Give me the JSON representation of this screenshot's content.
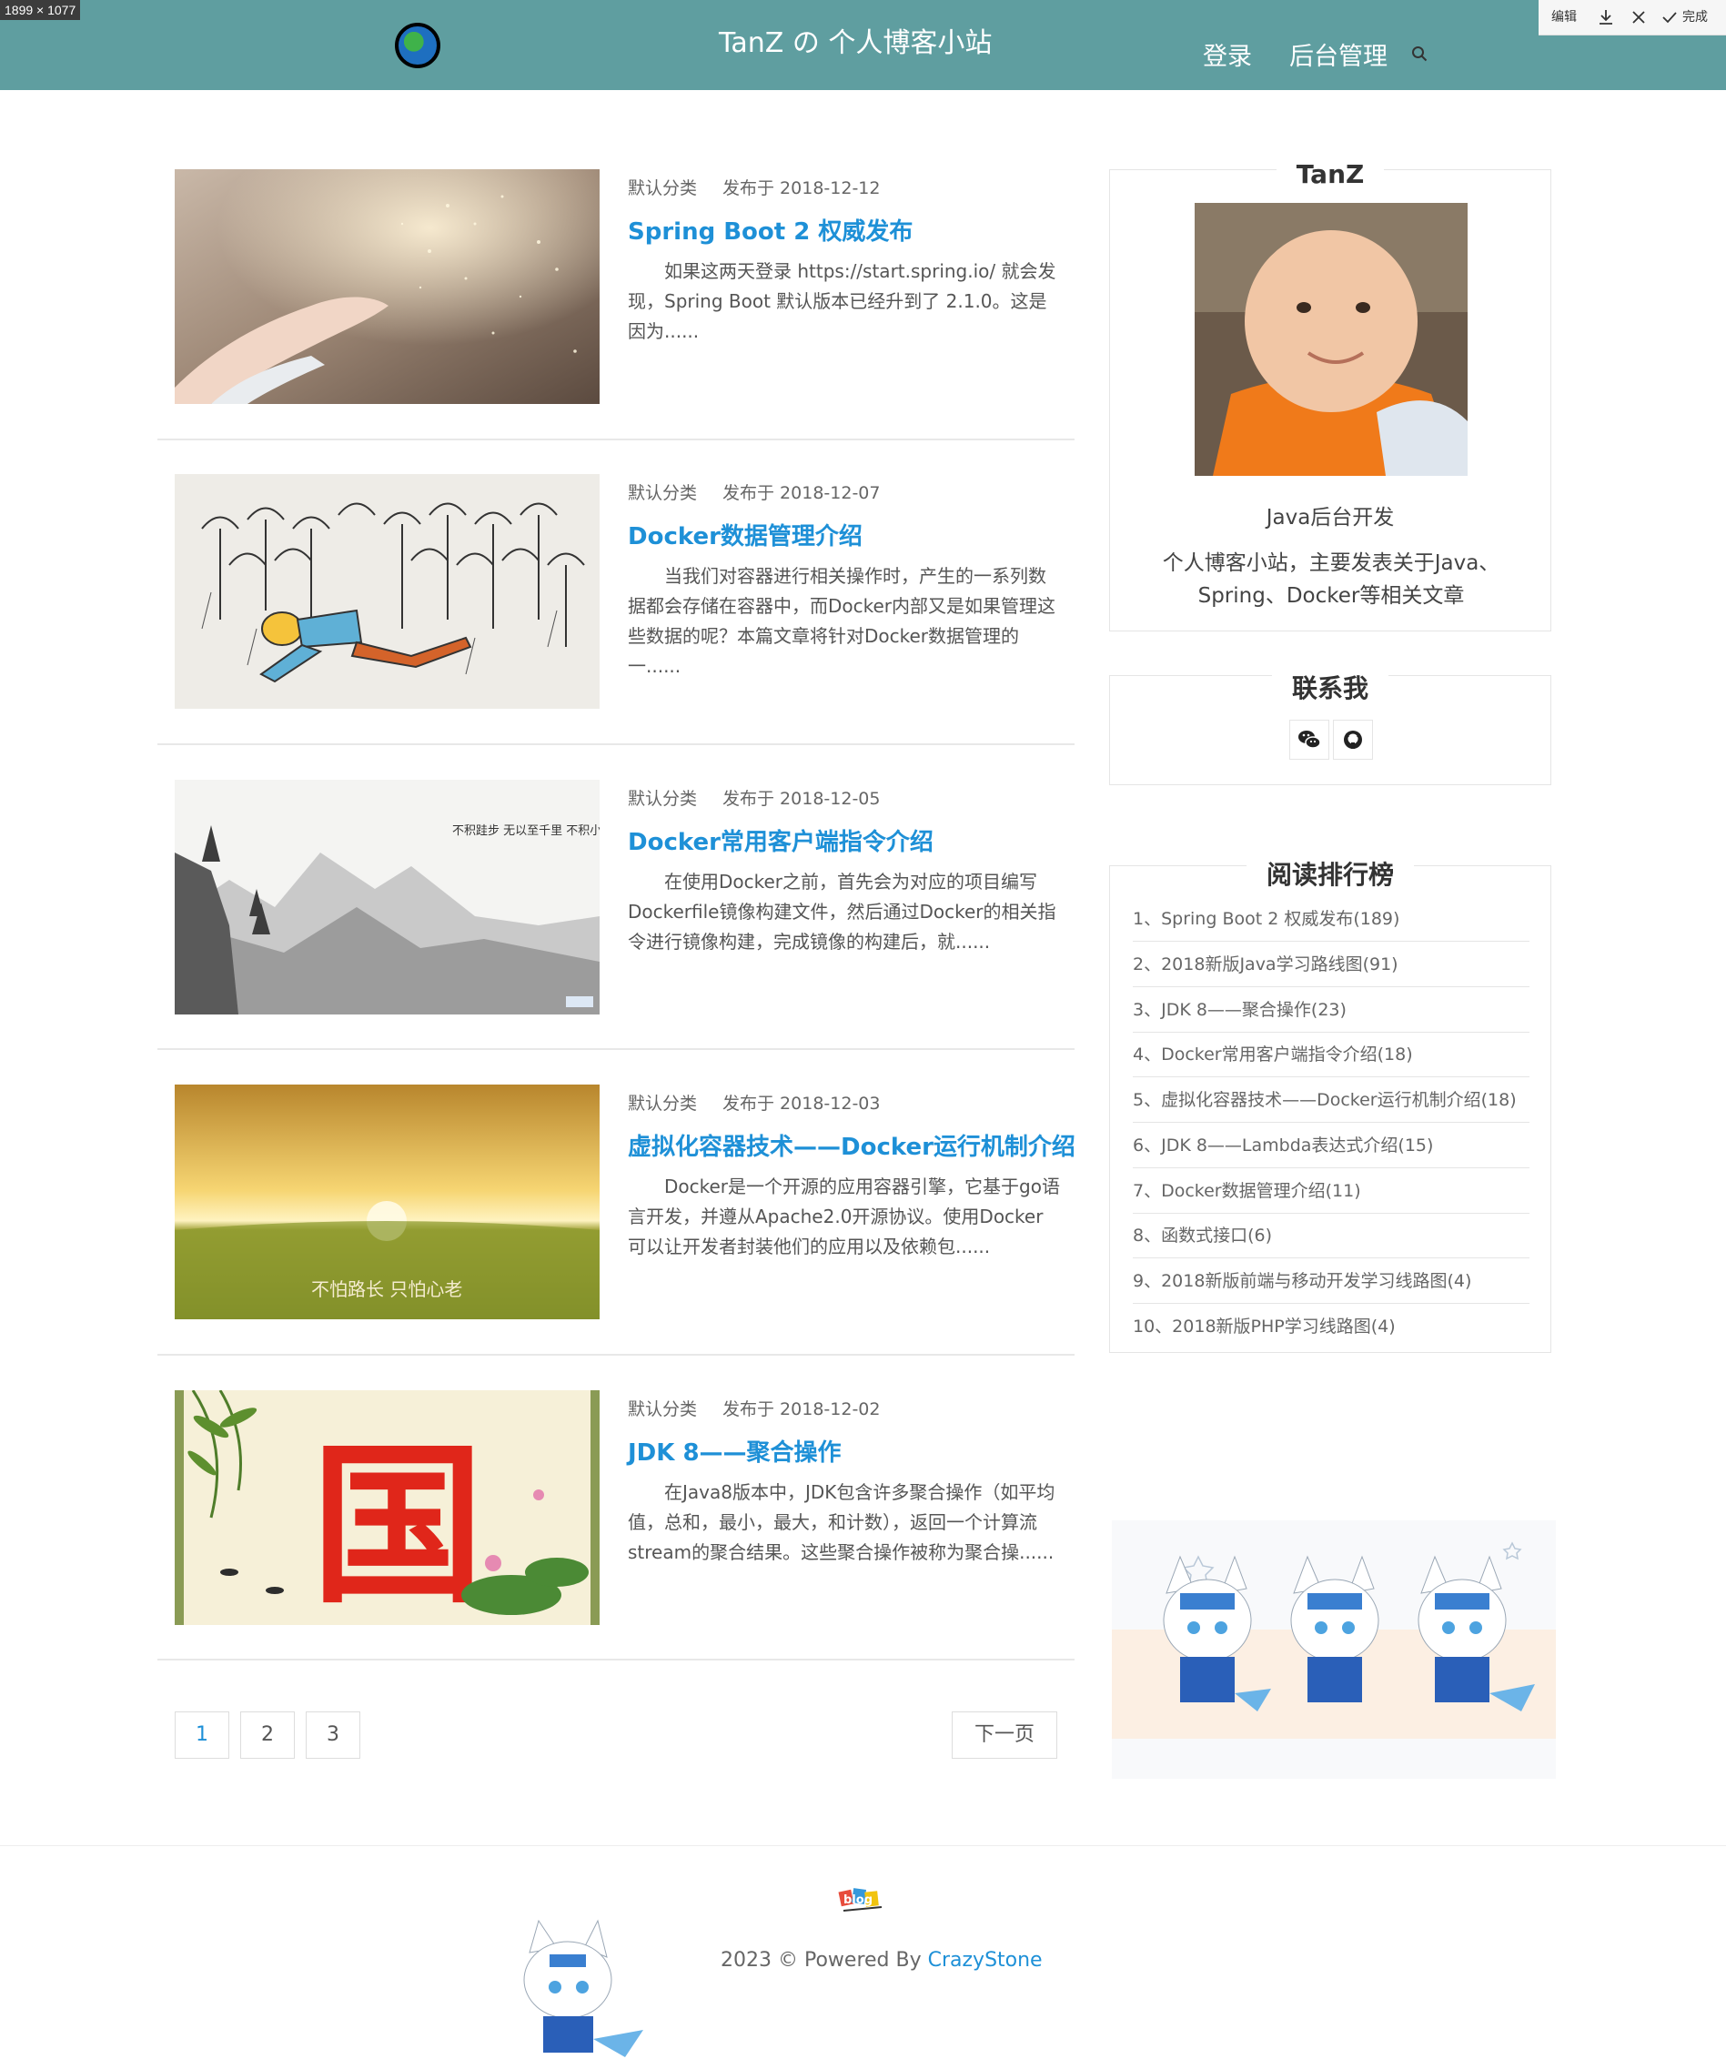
{
  "screen": {
    "dimension_tag": "1899 × 1077"
  },
  "colors": {
    "header_bg": "#5f9ea0",
    "link": "#1e90d7"
  },
  "header": {
    "site_title": "TanZ の 个人博客小站",
    "login": "登录",
    "admin": "后台管理",
    "search_icon": "search-icon"
  },
  "toolbar": {
    "edit": "编辑",
    "done": "完成"
  },
  "posts": [
    {
      "category": "默认分类",
      "date": "发布于 2018-12-12",
      "title": "Spring Boot 2 权威发布",
      "excerpt": "如果这两天登录 https://start.spring.io/ 就会发现，Spring Boot 默认版本已经升到了 2.1.0。这是因为......"
    },
    {
      "category": "默认分类",
      "date": "发布于 2018-12-07",
      "title": "Docker数据管理介绍",
      "excerpt": "当我们对容器进行相关操作时，产生的一系列数据都会存储在容器中，而Docker内部又是如果管理这些数据的呢？本篇文章将针对Docker数据管理的一......"
    },
    {
      "category": "默认分类",
      "date": "发布于 2018-12-05",
      "title": "Docker常用客户端指令介绍",
      "excerpt": "在使用Docker之前，首先会为对应的项目编写Dockerfile镜像构建文件，然后通过Docker的相关指令进行镜像构建，完成镜像的构建后，就......"
    },
    {
      "category": "默认分类",
      "date": "发布于 2018-12-03",
      "title": "虚拟化容器技术——Docker运行机制介绍",
      "excerpt": "Docker是一个开源的应用容器引擎，它基于go语言开发，并遵从Apache2.0开源协议。使用Docker可以让开发者封装他们的应用以及依赖包......"
    },
    {
      "category": "默认分类",
      "date": "发布于 2018-12-02",
      "title": "JDK 8——聚合操作",
      "excerpt": "在Java8版本中，JDK包含许多聚合操作（如平均值，总和，最小，最大，和计数），返回一个计算流stream的聚合结果。这些聚合操作被称为聚合操......"
    }
  ],
  "thumb_text": {
    "post3_poem": "不积跬步 无以至千里 不积小流 无以成江海",
    "post4_caption": "不怕路长 只怕心老",
    "post5_char": "国"
  },
  "pagination": {
    "pages": [
      "1",
      "2",
      "3"
    ],
    "current": "1",
    "next": "下一页"
  },
  "profile": {
    "name": "TanZ",
    "role": "Java后台开发",
    "bio": "个人博客小站，主要发表关于Java、Spring、Docker等相关文章"
  },
  "contact": {
    "title": "联系我",
    "icons": [
      "wechat-icon",
      "github-icon"
    ]
  },
  "ranking": {
    "title": "阅读排行榜",
    "items": [
      "1、Spring Boot 2 权威发布(189)",
      "2、2018新版Java学习路线图(91)",
      "3、JDK 8——聚合操作(23)",
      "4、Docker常用客户端指令介绍(18)",
      "5、虚拟化容器技术——Docker运行机制介绍(18)",
      "6、JDK 8——Lambda表达式介绍(15)",
      "7、Docker数据管理介绍(11)",
      "8、函数式接口(6)",
      "9、2018新版前端与移动开发学习线路图(4)",
      "10、2018新版PHP学习线路图(4)"
    ]
  },
  "footer": {
    "logo_text": "blog",
    "copyright_prefix": "2023 © Powered By ",
    "copyright_link": "CrazyStone"
  }
}
